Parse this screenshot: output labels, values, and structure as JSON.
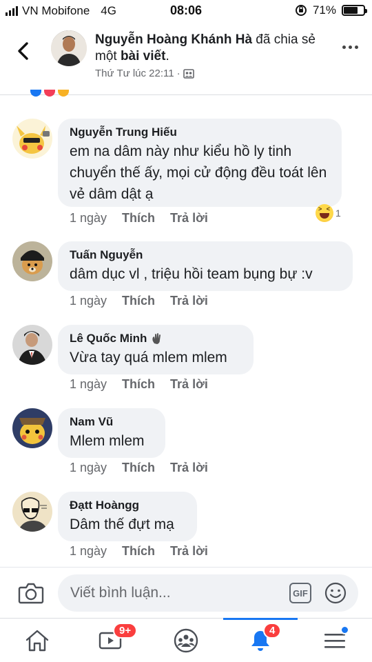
{
  "status_bar": {
    "carrier": "VN Mobifone",
    "network": "4G",
    "time": "08:06",
    "battery_percent": "71%",
    "battery_level": 0.71
  },
  "header": {
    "author": "Nguyễn Hoàng Khánh Hà",
    "action_text": " đã chia sẻ một ",
    "object_text": "bài viết",
    "end_punct": ".",
    "timestamp": "Thứ Tư lúc 22:11",
    "separator": " · "
  },
  "comments": [
    {
      "name": "Nguyễn Trung Hiếu",
      "text": "em na dâm này như kiểu hồ ly tinh chuyển thế ấy, mọi cử động đều toát lên vẻ dâm dật ạ",
      "time": "1 ngày",
      "like": "Thích",
      "reply": "Trả lời",
      "reaction_count": "1"
    },
    {
      "name": "Tuấn Nguyễn",
      "text": "dâm dục vl , triệu hồi team bụng bự :v",
      "time": "1 ngày",
      "like": "Thích",
      "reply": "Trả lời"
    },
    {
      "name": "Lê Quốc Minh",
      "text": "Vừa tay quá mlem mlem",
      "time": "1 ngày",
      "like": "Thích",
      "reply": "Trả lời"
    },
    {
      "name": "Nam Vũ",
      "text": "Mlem mlem",
      "time": "1 ngày",
      "like": "Thích",
      "reply": "Trả lời"
    },
    {
      "name": "Đạtt Hoàngg",
      "text": "Dâm thế đựt mạ",
      "time": "1 ngày",
      "like": "Thích",
      "reply": "Trả lời"
    }
  ],
  "composer": {
    "placeholder": "Viết bình luận...",
    "gif_label": "GIF"
  },
  "tab_bar": {
    "watch_badge": "9+",
    "notifications_badge": "4"
  },
  "colors": {
    "accent": "#1877f2",
    "badge": "#fa3e3e",
    "bubble": "#f0f2f5"
  }
}
